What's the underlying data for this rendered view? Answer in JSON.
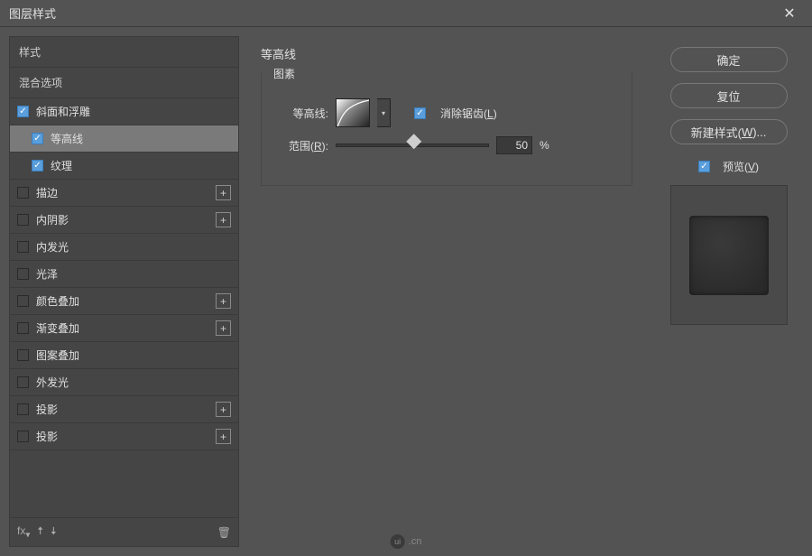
{
  "window": {
    "title": "图层样式",
    "close": "✕"
  },
  "left": {
    "header_styles": "样式",
    "header_blend": "混合选项",
    "items": [
      {
        "label": "斜面和浮雕",
        "checked": true,
        "sub": false,
        "plus": false
      },
      {
        "label": "等高线",
        "checked": true,
        "sub": true,
        "plus": false,
        "selected": true
      },
      {
        "label": "纹理",
        "checked": true,
        "sub": true,
        "plus": false
      },
      {
        "label": "描边",
        "checked": false,
        "sub": false,
        "plus": true
      },
      {
        "label": "内阴影",
        "checked": false,
        "sub": false,
        "plus": true
      },
      {
        "label": "内发光",
        "checked": false,
        "sub": false,
        "plus": false
      },
      {
        "label": "光泽",
        "checked": false,
        "sub": false,
        "plus": false
      },
      {
        "label": "颜色叠加",
        "checked": false,
        "sub": false,
        "plus": true
      },
      {
        "label": "渐变叠加",
        "checked": false,
        "sub": false,
        "plus": true
      },
      {
        "label": "图案叠加",
        "checked": false,
        "sub": false,
        "plus": false
      },
      {
        "label": "外发光",
        "checked": false,
        "sub": false,
        "plus": false
      },
      {
        "label": "投影",
        "checked": false,
        "sub": false,
        "plus": true
      },
      {
        "label": "投影",
        "checked": false,
        "sub": false,
        "plus": true
      }
    ],
    "footer_fx": "fx"
  },
  "center": {
    "title": "等高线",
    "group_label": "图素",
    "contour_label": "等高线:",
    "antialias_label": "消除锯齿(",
    "antialias_key": "L",
    "antialias_close": ")",
    "range_label": "范围(",
    "range_key": "R",
    "range_close": "):",
    "range_value": "50",
    "range_unit": "%"
  },
  "right": {
    "ok": "确定",
    "reset": "复位",
    "newstyle_pre": "新建样式(",
    "newstyle_key": "W",
    "newstyle_post": ")...",
    "preview_pre": "预览(",
    "preview_key": "V",
    "preview_post": ")"
  },
  "brand": {
    "text": ".cn",
    "badge": "ui"
  }
}
